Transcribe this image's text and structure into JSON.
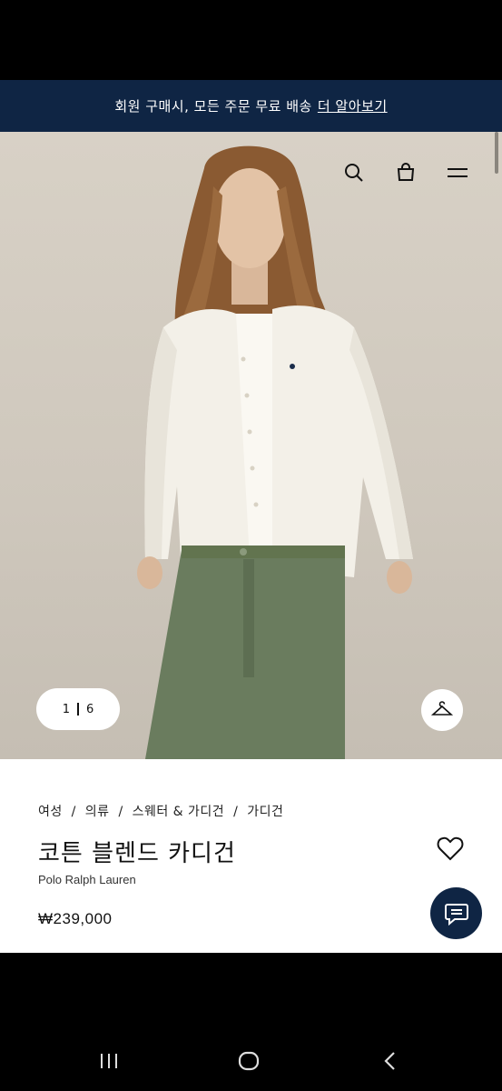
{
  "banner": {
    "text": "회원 구매시, 모든 주문 무료 배송",
    "link_label": "더 알아보기"
  },
  "header_icons": {
    "search": "search-icon",
    "bag": "shopping-bag-icon",
    "menu": "hamburger-menu-icon"
  },
  "gallery": {
    "current": "1",
    "total": "6",
    "hanger_icon": "hanger-icon"
  },
  "breadcrumb": {
    "items": [
      "여성",
      "의류",
      "스웨터 & 가디건",
      "가디건"
    ],
    "separator": "/"
  },
  "product": {
    "title": "코튼 블렌드 카디건",
    "brand": "Polo Ralph Lauren",
    "price": "₩239,000",
    "wishlist_icon": "heart-icon"
  },
  "chat": {
    "icon": "chat-icon"
  },
  "colors": {
    "navy": "#0f2544",
    "white": "#ffffff",
    "backdrop": "#d4cdc2",
    "cardigan": "#f3f0e8",
    "trousers": "#6a7c5e"
  }
}
